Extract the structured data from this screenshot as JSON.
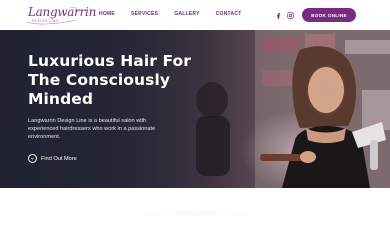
{
  "brand": {
    "logo_text": "Langwarrin",
    "logo_sub": "DESIGN LINE",
    "accent": "#7b2a84"
  },
  "nav": {
    "items": [
      {
        "label": "HOME"
      },
      {
        "label": "SERVICES"
      },
      {
        "label": "GALLERY"
      },
      {
        "label": "CONTACT"
      }
    ]
  },
  "social": {
    "facebook_icon": "facebook-icon",
    "instagram_icon": "instagram-icon"
  },
  "book_button": {
    "label": "BOOK ONLINE"
  },
  "hero": {
    "title_lines": [
      "Luxurious Hair For",
      "The Consciously",
      "Minded"
    ],
    "description": "Langwarrin Design Line is a beautiful salon with experienced hairdressers who work in a passionate environment.",
    "cta_label": "Find Out More",
    "cta_icon": "chevron-down-icon"
  }
}
